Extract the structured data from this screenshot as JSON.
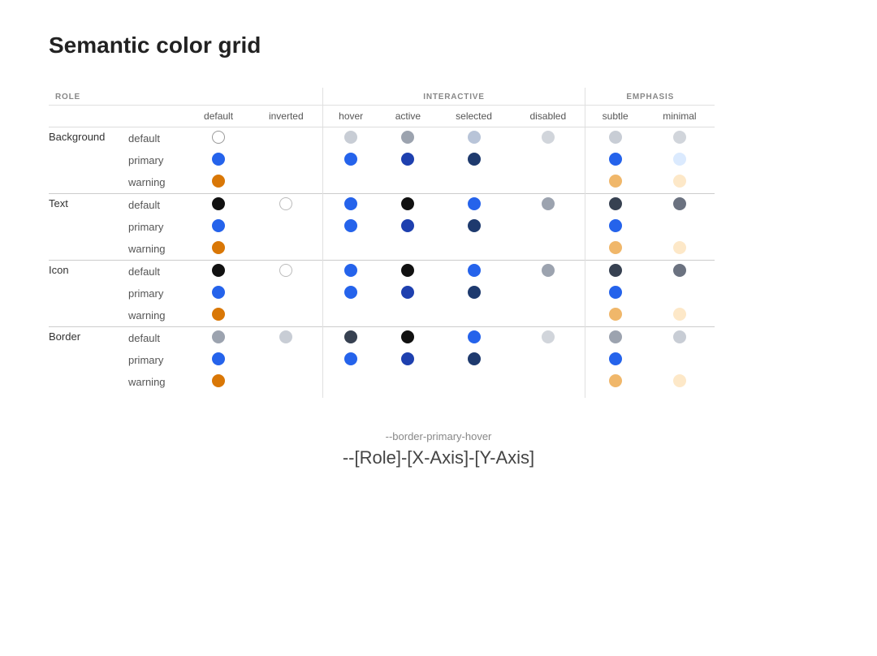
{
  "title": "Semantic color grid",
  "footer": {
    "code_example": "--border-primary-hover",
    "pattern": "--[Role]-[X-Axis]-[Y-Axis]"
  },
  "header": {
    "role_label": "ROLE",
    "groups": [
      {
        "label": "",
        "cols": 2
      },
      {
        "label": "INTERACTIVE",
        "cols": 4
      },
      {
        "label": "EMPHASIS",
        "cols": 2
      }
    ],
    "columns": [
      "default",
      "inverted",
      "hover",
      "active",
      "selected",
      "disabled",
      "subtle",
      "minimal"
    ]
  },
  "roles": [
    {
      "name": "Background",
      "rows": [
        {
          "sub": "default",
          "default": "white-outline",
          "inverted": "",
          "hover": "light-gray",
          "active": "mid-gray",
          "selected": "light-blue-gray",
          "disabled": "gray-lighter",
          "subtle": "light-gray",
          "minimal": "gray-lighter"
        },
        {
          "sub": "primary",
          "default": "blue",
          "inverted": "",
          "hover": "blue",
          "active": "blue-dark",
          "selected": "blue-navy",
          "disabled": "",
          "subtle": "blue",
          "minimal": "blue-minimal"
        },
        {
          "sub": "warning",
          "default": "orange",
          "inverted": "",
          "hover": "",
          "active": "",
          "selected": "",
          "disabled": "",
          "subtle": "orange-subtle",
          "minimal": "orange-minimal"
        }
      ]
    },
    {
      "name": "Text",
      "rows": [
        {
          "sub": "default",
          "default": "black",
          "inverted": "white",
          "hover": "blue",
          "active": "black",
          "selected": "blue",
          "disabled": "mid-gray",
          "subtle": "dark-gray",
          "minimal": "medium-gray"
        },
        {
          "sub": "primary",
          "default": "blue",
          "inverted": "",
          "hover": "blue",
          "active": "blue-dark",
          "selected": "blue-navy",
          "disabled": "",
          "subtle": "blue",
          "minimal": ""
        },
        {
          "sub": "warning",
          "default": "orange",
          "inverted": "",
          "hover": "",
          "active": "",
          "selected": "",
          "disabled": "",
          "subtle": "orange-subtle",
          "minimal": "orange-minimal"
        }
      ]
    },
    {
      "name": "Icon",
      "rows": [
        {
          "sub": "default",
          "default": "black",
          "inverted": "white",
          "hover": "blue",
          "active": "black",
          "selected": "blue",
          "disabled": "mid-gray",
          "subtle": "dark-gray",
          "minimal": "medium-gray"
        },
        {
          "sub": "primary",
          "default": "blue",
          "inverted": "",
          "hover": "blue",
          "active": "blue-dark",
          "selected": "blue-navy",
          "disabled": "",
          "subtle": "blue",
          "minimal": ""
        },
        {
          "sub": "warning",
          "default": "orange",
          "inverted": "",
          "hover": "",
          "active": "",
          "selected": "",
          "disabled": "",
          "subtle": "orange-subtle",
          "minimal": "orange-minimal"
        }
      ]
    },
    {
      "name": "Border",
      "rows": [
        {
          "sub": "default",
          "default": "gray-border",
          "inverted": "gray-border-light",
          "hover": "dark-gray",
          "active": "black",
          "selected": "blue",
          "disabled": "gray-lighter",
          "subtle": "gray-border",
          "minimal": "gray-border-light"
        },
        {
          "sub": "primary",
          "default": "blue",
          "inverted": "",
          "hover": "blue",
          "active": "blue-dark",
          "selected": "blue-navy",
          "disabled": "",
          "subtle": "blue",
          "minimal": ""
        },
        {
          "sub": "warning",
          "default": "orange",
          "inverted": "",
          "hover": "",
          "active": "",
          "selected": "",
          "disabled": "",
          "subtle": "orange-subtle",
          "minimal": "orange-minimal"
        }
      ]
    }
  ]
}
